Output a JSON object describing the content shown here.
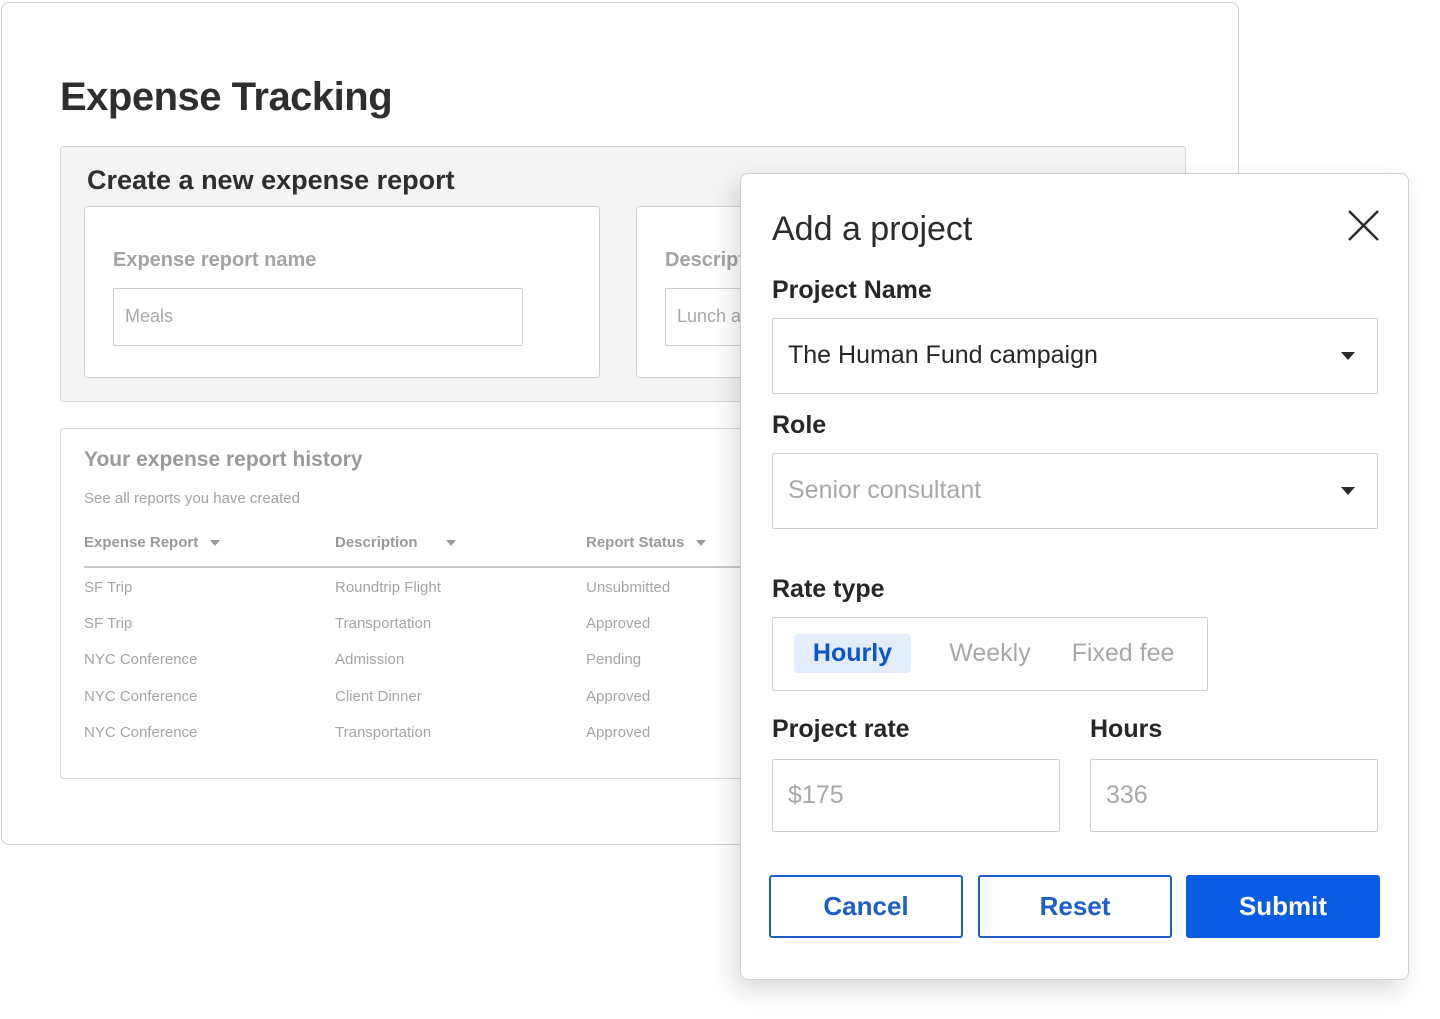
{
  "page": {
    "title": "Expense Tracking"
  },
  "create_report": {
    "title": "Create a new expense report",
    "fields": [
      {
        "label": "Expense report name",
        "placeholder": "Meals"
      },
      {
        "label": "Description",
        "placeholder": "Lunch at"
      }
    ]
  },
  "history": {
    "title": "Your expense report history",
    "subtitle": "See all reports you have created",
    "columns": [
      "Expense Report",
      "Description",
      "Report Status"
    ],
    "rows": [
      [
        "SF Trip",
        "Roundtrip Flight",
        "Unsubmitted"
      ],
      [
        "SF Trip",
        "Transportation",
        "Approved"
      ],
      [
        "NYC Conference",
        "Admission",
        "Pending"
      ],
      [
        "NYC Conference",
        "Client Dinner",
        "Approved"
      ],
      [
        "NYC Conference",
        "Transportation",
        "Approved"
      ]
    ]
  },
  "modal": {
    "title": "Add a project",
    "close_icon": "close-x-icon",
    "project_name": {
      "label": "Project Name",
      "value": "The Human Fund campaign"
    },
    "role": {
      "label": "Role",
      "placeholder": "Senior consultant"
    },
    "rate_type": {
      "label": "Rate type",
      "options": [
        "Hourly",
        "Weekly",
        "Fixed fee"
      ],
      "selected": "Hourly"
    },
    "project_rate": {
      "label": "Project rate",
      "placeholder": "$175"
    },
    "hours": {
      "label": "Hours",
      "placeholder": "336"
    },
    "buttons": {
      "cancel": "Cancel",
      "reset": "Reset",
      "submit": "Submit"
    }
  },
  "colors": {
    "primary": "#0a5ce3",
    "outline_button": "#1d5fc9",
    "selected_segment_bg": "#e3edfc",
    "selected_segment_text": "#0b55d0"
  }
}
